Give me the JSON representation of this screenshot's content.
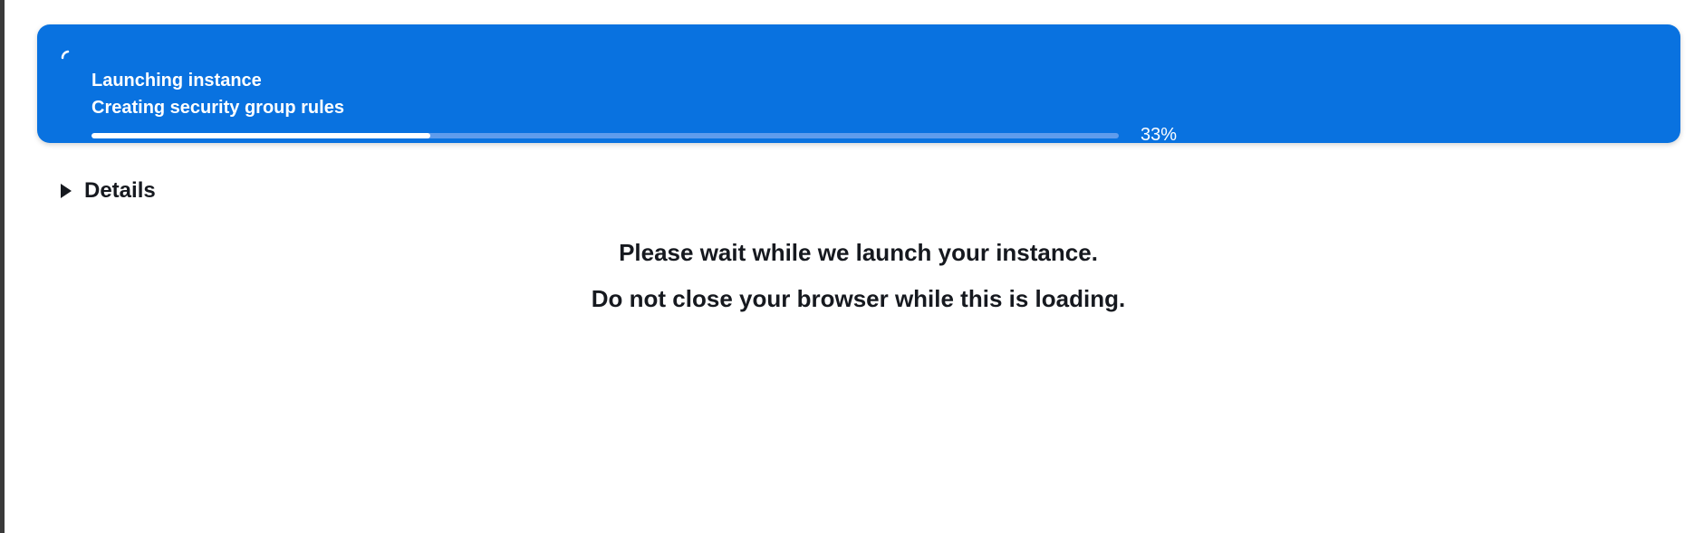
{
  "flash": {
    "title": "Launching instance",
    "subtitle": "Creating security group rules",
    "progress_percent": 33,
    "progress_label": "33%",
    "status": "in-progress",
    "background_color": "#0972e0",
    "spinner_icon": "loading-spinner-icon"
  },
  "details": {
    "label": "Details",
    "expanded": false,
    "icon": "caret-right-icon"
  },
  "message": {
    "line1": "Please wait while we launch your instance.",
    "line2": "Do not close your browser while this is loading."
  }
}
